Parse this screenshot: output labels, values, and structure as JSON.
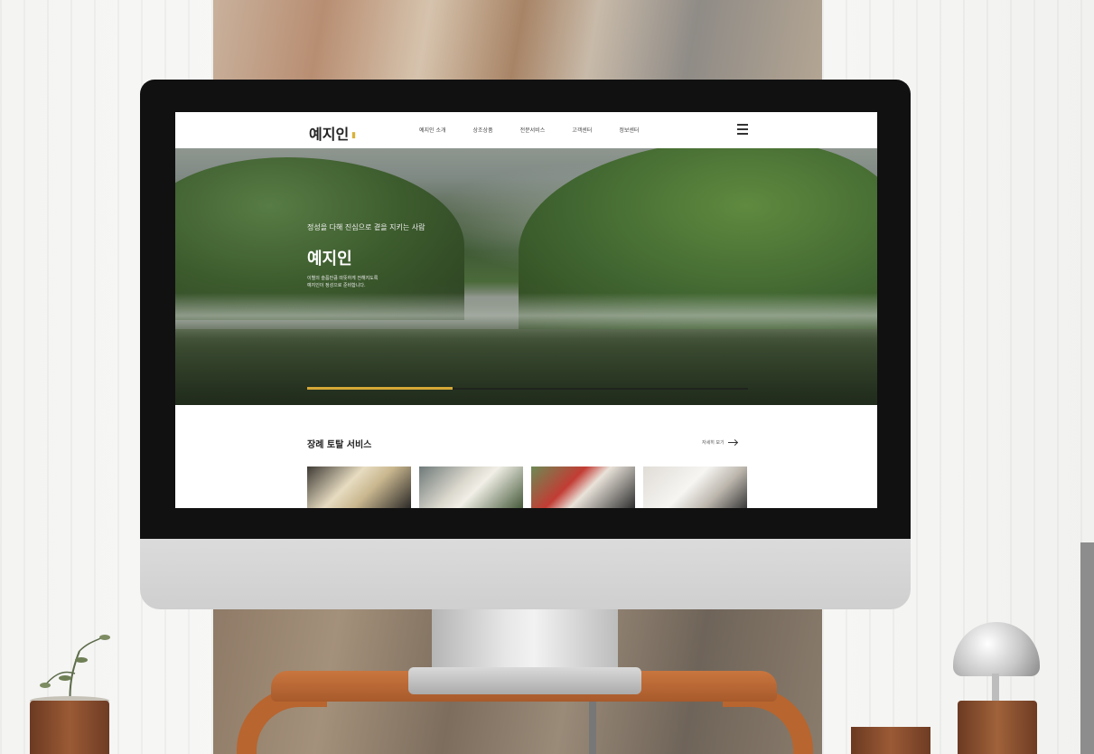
{
  "site": {
    "logo": "예지인",
    "nav": [
      "예지인 소개",
      "상조상품",
      "전문서비스",
      "고객센터",
      "정보센터"
    ]
  },
  "hero": {
    "subtitle": "정성을 다해 진심으로 곁을 지키는 사람",
    "title": "예지인",
    "description_line1": "이별의 슬픔만큼 따뜻하게 전해지도록",
    "description_line2": "예지인이 정성으로 준비합니다.",
    "slide_progress": 0.33
  },
  "services": {
    "title": "장례 토탈 서비스",
    "more_label": "자세히 보기"
  },
  "colors": {
    "accent": "#d4a737",
    "text_dark": "#222222"
  }
}
